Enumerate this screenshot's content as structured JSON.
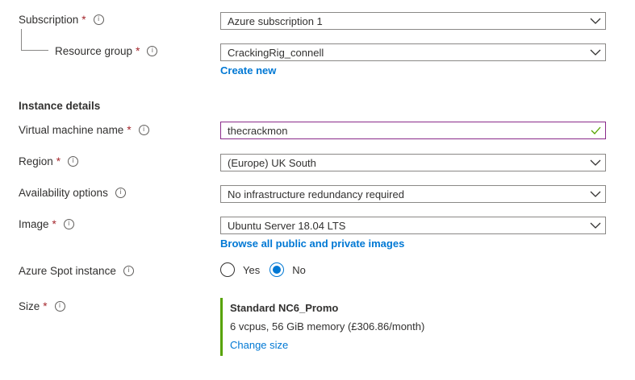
{
  "subscription": {
    "label": "Subscription",
    "required": "*",
    "value": "Azure subscription 1"
  },
  "resource_group": {
    "label": "Resource group",
    "required": "*",
    "value": "CrackingRig_connell",
    "create_new": "Create new"
  },
  "instance_details": {
    "title": "Instance details"
  },
  "vm_name": {
    "label": "Virtual machine name",
    "required": "*",
    "value": "thecrackmon"
  },
  "region": {
    "label": "Region",
    "required": "*",
    "value": "(Europe) UK South"
  },
  "availability": {
    "label": "Availability options",
    "value": "No infrastructure redundancy required"
  },
  "image": {
    "label": "Image",
    "required": "*",
    "value": "Ubuntu Server 18.04 LTS",
    "browse": "Browse all public and private images"
  },
  "spot": {
    "label": "Azure Spot instance",
    "yes": "Yes",
    "no": "No",
    "selected": "No"
  },
  "size": {
    "label": "Size",
    "required": "*",
    "name": "Standard NC6_Promo",
    "description": "6 vcpus, 56 GiB memory (£306.86/month)",
    "change": "Change size"
  },
  "colors": {
    "link": "#0078d4",
    "required": "#a4262c",
    "valid_check": "#57a300",
    "size_accent": "#57a300"
  }
}
